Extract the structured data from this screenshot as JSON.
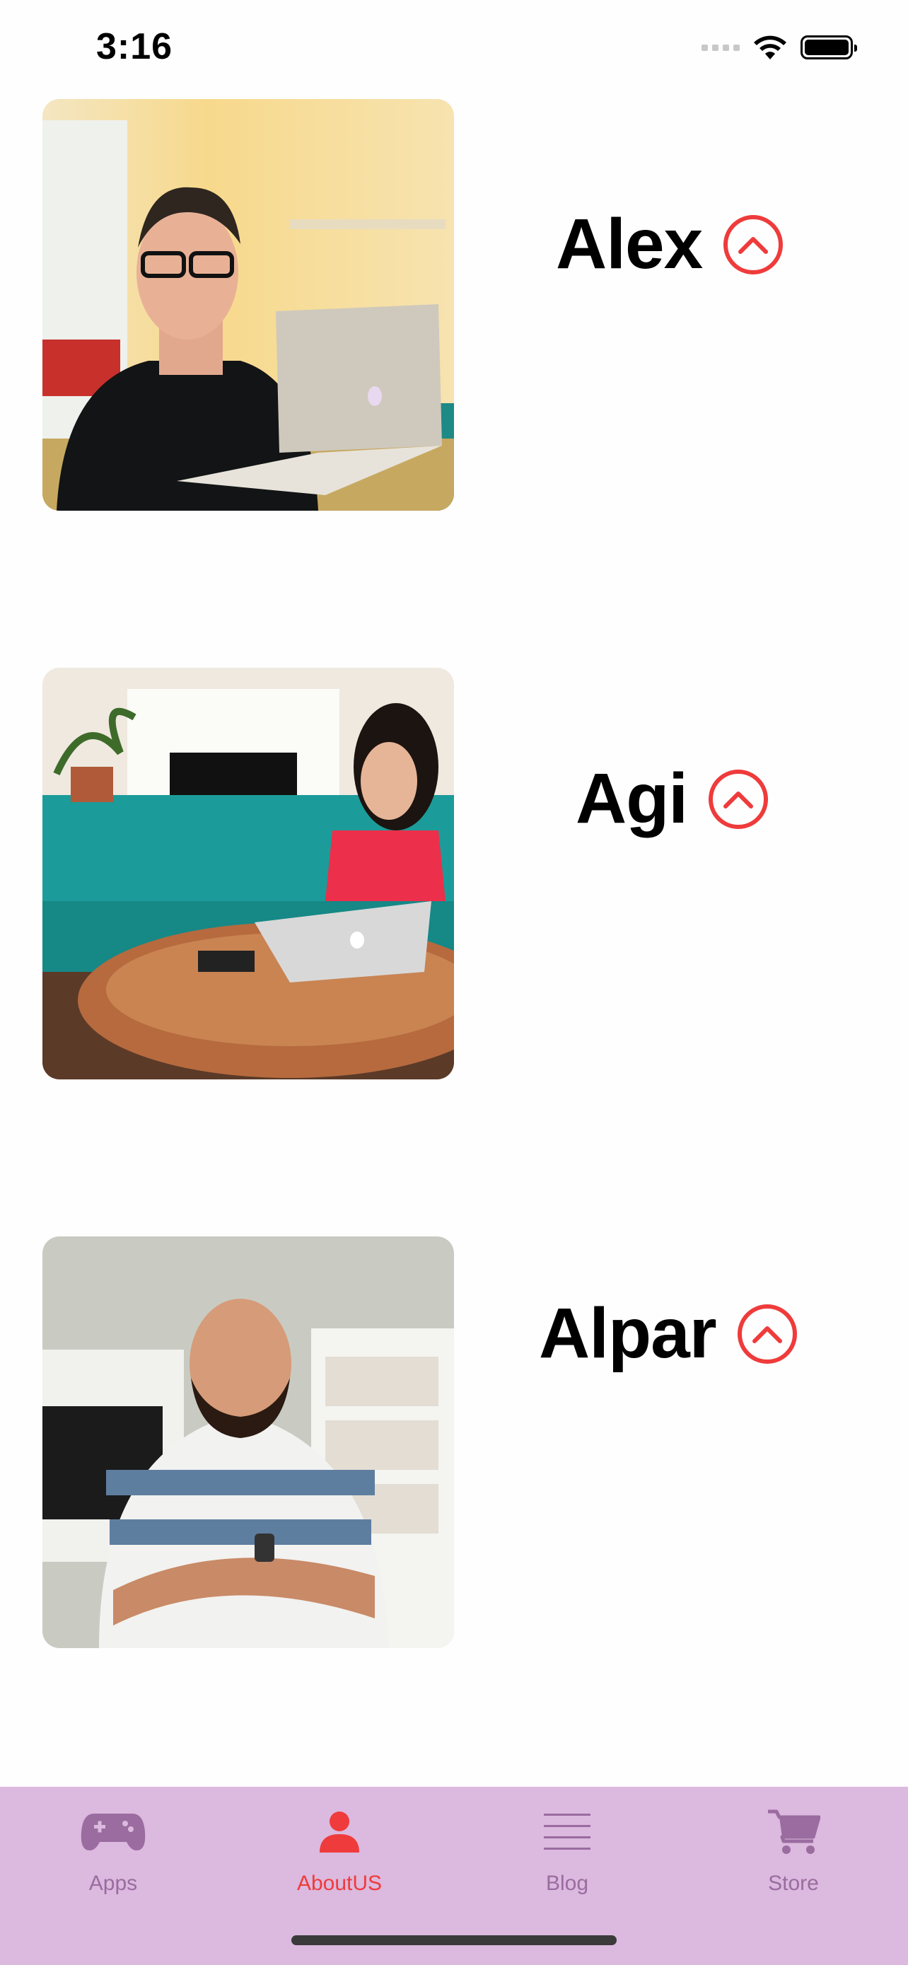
{
  "status_bar": {
    "time": "3:16"
  },
  "team": [
    {
      "name": "Alex"
    },
    {
      "name": "Agi"
    },
    {
      "name": "Alpar"
    }
  ],
  "tabs": [
    {
      "label": "Apps",
      "icon": "gamepad-icon"
    },
    {
      "label": "AboutUS",
      "icon": "person-icon",
      "active": true
    },
    {
      "label": "Blog",
      "icon": "list-icon"
    },
    {
      "label": "Store",
      "icon": "cart-icon"
    }
  ],
  "colors": {
    "accent": "#ef3b3b",
    "tabbar_bg": "#dcb9de",
    "tab_inactive": "#9a6ca0"
  }
}
